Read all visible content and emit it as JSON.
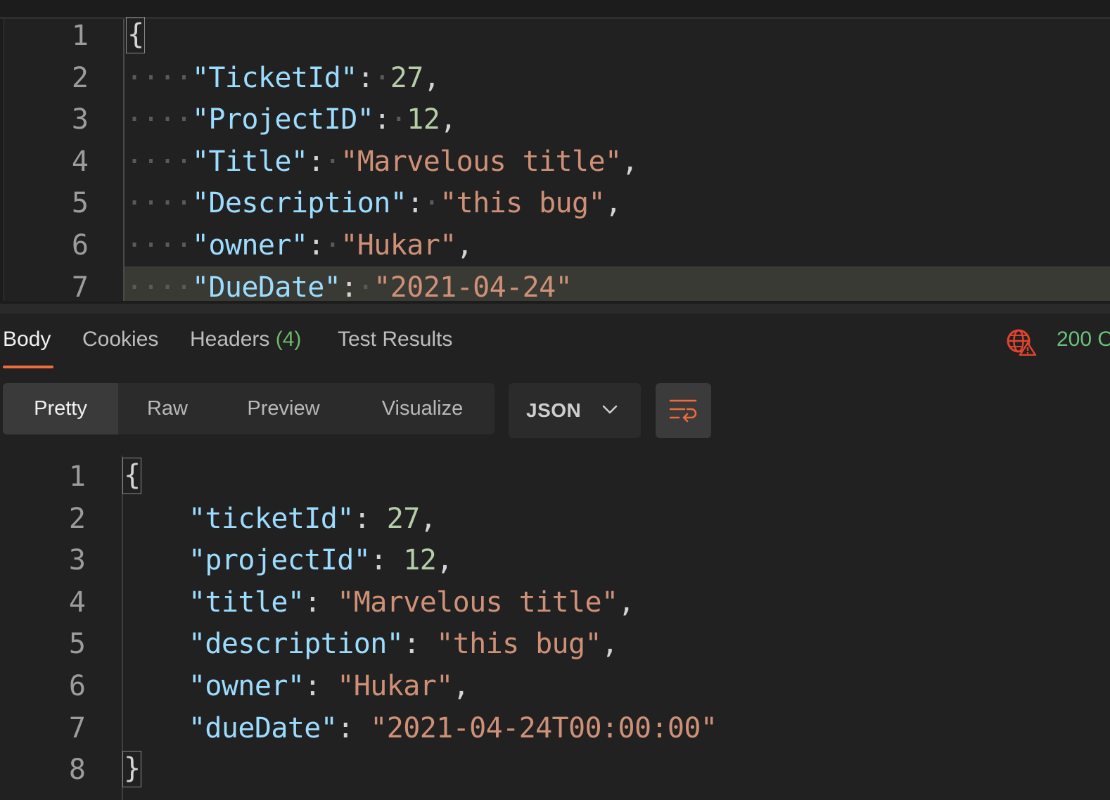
{
  "request_editor": {
    "lines": [
      {
        "num": "1",
        "brace": "{"
      },
      {
        "num": "2",
        "key": "\"TicketId\"",
        "value": "27",
        "vtype": "n",
        "comma": ","
      },
      {
        "num": "3",
        "key": "\"ProjectID\"",
        "value": "12",
        "vtype": "n",
        "comma": ","
      },
      {
        "num": "4",
        "key": "\"Title\"",
        "value": "\"Marvelous title\"",
        "vtype": "s",
        "comma": ","
      },
      {
        "num": "5",
        "key": "\"Description\"",
        "value": "\"this bug\"",
        "vtype": "s",
        "comma": ","
      },
      {
        "num": "6",
        "key": "\"owner\"",
        "value": "\"Hukar\"",
        "vtype": "s",
        "comma": ","
      },
      {
        "num": "7",
        "key": "\"DueDate\"",
        "value": "\"2021-04-24\"",
        "vtype": "s",
        "comma": ""
      }
    ]
  },
  "response_tabs": {
    "body": "Body",
    "cookies": "Cookies",
    "headers": "Headers",
    "headers_count": "(4)",
    "test_results": "Test Results"
  },
  "status": {
    "code_text": "200 O",
    "icon": "globe-warning-icon",
    "icon_color": "#e0442f",
    "text_color": "#6cbf7a"
  },
  "view_modes": {
    "pretty": "Pretty",
    "raw": "Raw",
    "preview": "Preview",
    "visualize": "Visualize"
  },
  "format_select": {
    "value": "JSON",
    "icon": "chevron-down-icon"
  },
  "wrap_button": {
    "icon": "word-wrap-icon",
    "color": "#f26b3a"
  },
  "response_body": {
    "lines": [
      {
        "num": "1",
        "brace": "{"
      },
      {
        "num": "2",
        "key": "\"ticketId\"",
        "value": "27",
        "vtype": "n",
        "comma": ","
      },
      {
        "num": "3",
        "key": "\"projectId\"",
        "value": "12",
        "vtype": "n",
        "comma": ","
      },
      {
        "num": "4",
        "key": "\"title\"",
        "value": "\"Marvelous title\"",
        "vtype": "s",
        "comma": ","
      },
      {
        "num": "5",
        "key": "\"description\"",
        "value": "\"this bug\"",
        "vtype": "s",
        "comma": ","
      },
      {
        "num": "6",
        "key": "\"owner\"",
        "value": "\"Hukar\"",
        "vtype": "s",
        "comma": ","
      },
      {
        "num": "7",
        "key": "\"dueDate\"",
        "value": "\"2021-04-24T00:00:00\"",
        "vtype": "s",
        "comma": ""
      },
      {
        "num": "8",
        "brace": "}"
      }
    ]
  },
  "colors": {
    "accent": "#f26b3a",
    "key": "#9cdcfe",
    "string": "#ce9178",
    "number": "#b5cea8",
    "background": "#212121"
  }
}
